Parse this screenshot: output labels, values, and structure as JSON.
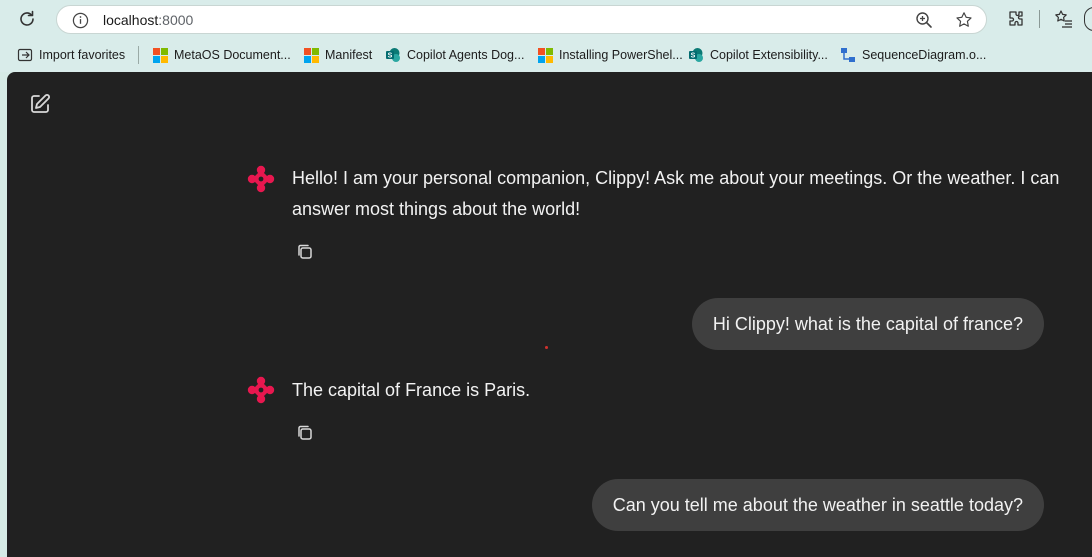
{
  "browser": {
    "url_host": "localhost",
    "url_port": ":8000",
    "bookmarks": [
      {
        "label": "Import favorites",
        "icon": "import-favorites-icon"
      },
      {
        "label": "MetaOS Document...",
        "icon": "microsoft-logo-icon"
      },
      {
        "label": "Manifest",
        "icon": "microsoft-logo-icon"
      },
      {
        "label": "Copilot Agents Dog...",
        "icon": "sharepoint-icon"
      },
      {
        "label": "Installing PowerShel...",
        "icon": "microsoft-logo-icon"
      },
      {
        "label": "Copilot Extensibility...",
        "icon": "sharepoint-icon"
      },
      {
        "label": "SequenceDiagram.o...",
        "icon": "sequence-diagram-icon"
      }
    ]
  },
  "chat": {
    "messages": [
      {
        "role": "assistant",
        "text": "Hello! I am your personal companion, Clippy! Ask me about your meetings. Or the weather. I can answer most things about the world!"
      },
      {
        "role": "user",
        "text": "Hi Clippy! what is the capital of france?"
      },
      {
        "role": "assistant",
        "text": "The capital of France is Paris."
      },
      {
        "role": "user",
        "text": "Can you tell me about the weather in seattle today?"
      }
    ]
  },
  "colors": {
    "chrome_bg": "#d9ecea",
    "app_bg": "#212121",
    "user_bubble": "#3f3f3f",
    "bot_accent": "#e8174f"
  }
}
